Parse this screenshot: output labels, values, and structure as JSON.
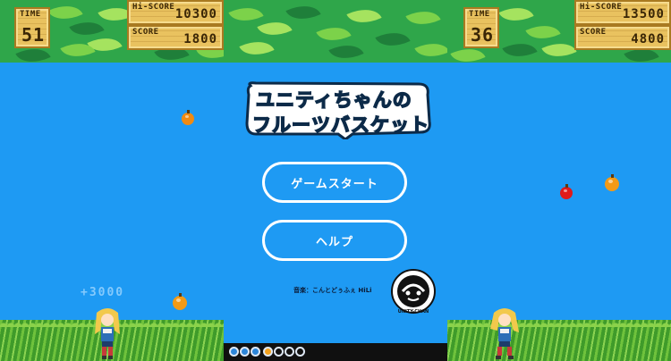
{
  "hud_left": {
    "time_label": "TIME",
    "time_value": "51",
    "hiscore_label": "Hi-SCORE",
    "hiscore_value": "10300",
    "score_label": "SCORE",
    "score_value": "1800"
  },
  "hud_right": {
    "time_label": "TIME",
    "time_value": "36",
    "hiscore_label": "Hi-SCORE",
    "hiscore_value": "13500",
    "score_label": "SCORE",
    "score_value": "4800"
  },
  "logo": {
    "line1": "ユニティちゃんの",
    "line2_chars": [
      "フ",
      "ル",
      "ー",
      "ツ",
      "バ",
      "ス",
      "ケ",
      "ッ",
      "ト"
    ],
    "line2_colors": [
      "#ff3b3b",
      "#ff7a1a",
      "#ffd400",
      "#c03bff",
      "#ffffff",
      "#ffffff",
      "#ffffff",
      "#ffffff",
      "#ffffff"
    ]
  },
  "menu": {
    "start_label": "ゲームスタート",
    "help_label": "ヘルプ"
  },
  "credit": "音楽：こんとどぅふぇ HiLi",
  "score_popup": "+3000",
  "emblem_text": "UNITY-CHAN",
  "colors": {
    "sky": "#1e9af3",
    "hud_wood": "#e9c25f",
    "button_border": "#ffffff"
  }
}
